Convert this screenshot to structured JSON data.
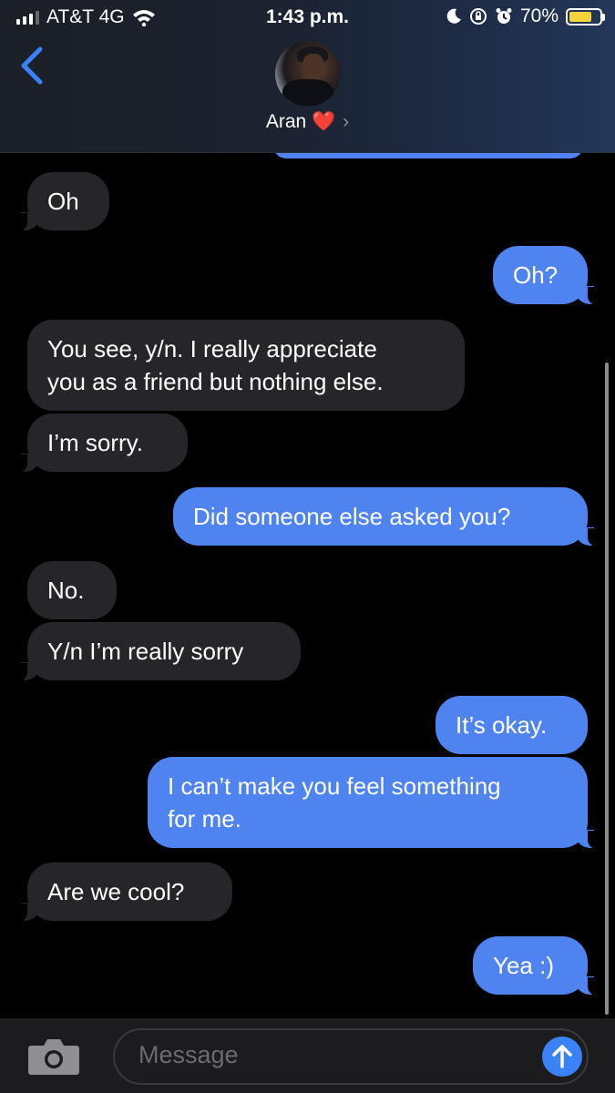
{
  "status_bar": {
    "carrier": "AT&T 4G",
    "time": "1:43 p.m.",
    "battery": "70%",
    "battery_level": 0.7,
    "icons": [
      "signal-icon",
      "wifi-icon",
      "moon-icon",
      "rotation-lock-icon",
      "alarm-icon",
      "battery-icon"
    ]
  },
  "header": {
    "contact_name": "Aran ❤️",
    "chevron": "›"
  },
  "messages": [
    {
      "side": "in",
      "text": "Oh"
    },
    {
      "side": "out",
      "text": "Oh?"
    },
    {
      "side": "in",
      "text": "You see, y/n. I really appreciate\nyou as a friend but nothing else."
    },
    {
      "side": "in",
      "text": "I’m sorry."
    },
    {
      "side": "out",
      "text": "Did someone else asked you?"
    },
    {
      "side": "in",
      "text": "No."
    },
    {
      "side": "in",
      "text": "Y/n I’m really sorry"
    },
    {
      "side": "out",
      "text": "It’s okay."
    },
    {
      "side": "out",
      "text": "I can’t make you feel something\nfor me."
    },
    {
      "side": "in",
      "text": "Are we cool?"
    },
    {
      "side": "out",
      "text": "Yea :)"
    }
  ],
  "input": {
    "placeholder": "Message"
  },
  "colors": {
    "outgoing": "#4f84f0",
    "incoming": "#26262a",
    "send": "#3a82f7"
  }
}
